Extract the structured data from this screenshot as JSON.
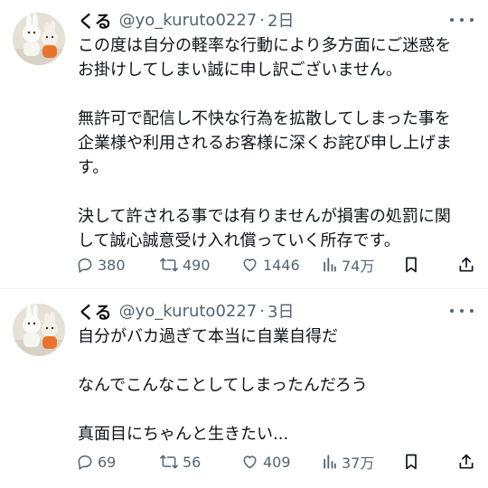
{
  "colors": {
    "text": "#0f1419",
    "secondary": "#536471",
    "divider": "#eff3f4",
    "background": "#ffffff"
  },
  "tweets": [
    {
      "name": "くる",
      "handle": "@yo_kuruto0227",
      "separator": "·",
      "time": "2日",
      "lines": [
        "この度は自分の軽率な行動により多方面にご迷惑を",
        "お掛けしてしまい誠に申し訳ございません。",
        "",
        "無許可で配信し不快な行為を拡散してしまった事を",
        "企業様や利用されるお客様に深くお詫び申し上げま",
        "す。",
        "",
        "決して許される事では有りませんが損害の処罰に関",
        "して誠心誠意受け入れ償っていく所存です。"
      ],
      "replies": "380",
      "retweets": "490",
      "likes": "1446",
      "views": "74万"
    },
    {
      "name": "くる",
      "handle": "@yo_kuruto0227",
      "separator": "·",
      "time": "3日",
      "lines": [
        "自分がバカ過ぎて本当に自業自得だ",
        "",
        "なんでこんなことしてしまったんだろう",
        "",
        "真面目にちゃんと生きたい..."
      ],
      "replies": "69",
      "retweets": "56",
      "likes": "409",
      "views": "37万"
    }
  ]
}
